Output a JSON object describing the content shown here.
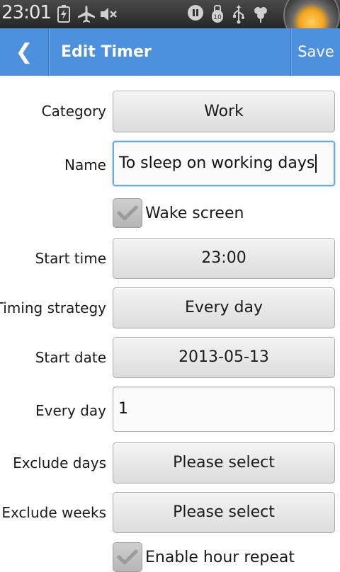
{
  "status_bar": {
    "time": "23:01",
    "icons": [
      "battery-charging-icon",
      "airplane-icon",
      "mute-icon",
      "media-icon",
      "notification-icon",
      "usb-icon",
      "clover-icon"
    ]
  },
  "header": {
    "back_label": "❮",
    "title": "Edit Timer",
    "save_label": "Save"
  },
  "form": {
    "category": {
      "label": "Category",
      "value": "Work"
    },
    "name": {
      "label": "Name",
      "value": "To sleep on working days"
    },
    "wake_screen": {
      "label": "Wake screen",
      "checked": true
    },
    "start_time": {
      "label": "Start time",
      "value": "23:00"
    },
    "timing_strategy": {
      "label": "Timing strategy",
      "value": "Every day"
    },
    "start_date": {
      "label": "Start date",
      "value": "2013-05-13"
    },
    "every_day": {
      "label": "Every day",
      "value": "1"
    },
    "exclude_days": {
      "label": "Exclude days",
      "value": "Please select"
    },
    "exclude_weeks": {
      "label": "Exclude weeks",
      "value": "Please select"
    },
    "hour_repeat": {
      "label": "Enable hour repeat",
      "checked": true
    }
  },
  "colors": {
    "header_bg": "#4d90de",
    "focus_border": "#6aa7e8"
  }
}
